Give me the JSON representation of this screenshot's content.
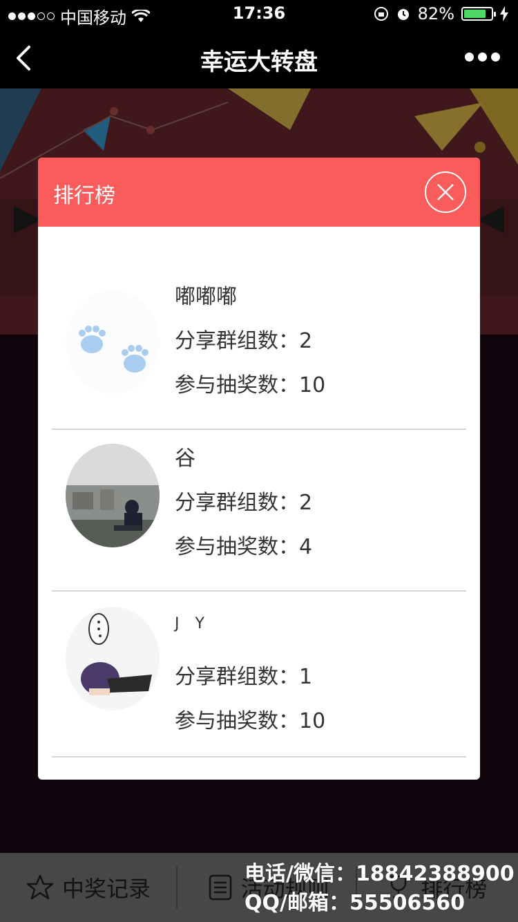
{
  "status_bar": {
    "carrier": "中国移动",
    "time": "17:36",
    "battery": "82%",
    "battery_level": 0.82
  },
  "navbar": {
    "title": "幸运大转盘"
  },
  "modal": {
    "title": "排行榜",
    "labels": {
      "share_groups": "分享群组数：",
      "draws": "参与抽奖数："
    },
    "entries": [
      {
        "name": "嘟嘟嘟",
        "share_groups": "2",
        "draws": "10"
      },
      {
        "name": "谷",
        "share_groups": "2",
        "draws": "4"
      },
      {
        "name": "J Y",
        "share_groups": "1",
        "draws": "10"
      }
    ]
  },
  "tabbar": {
    "tabs": [
      {
        "label": "中奖记录",
        "icon": "star-icon"
      },
      {
        "label": "活动规则",
        "icon": "document-icon"
      },
      {
        "label": "排行榜",
        "icon": "trophy-icon"
      }
    ]
  },
  "watermark": {
    "line1": "电话/微信：18842388900",
    "line2": "QQ/邮箱：55506560"
  },
  "colors": {
    "header_red": "#fa5c5c",
    "battery_green": "#4cd964"
  }
}
